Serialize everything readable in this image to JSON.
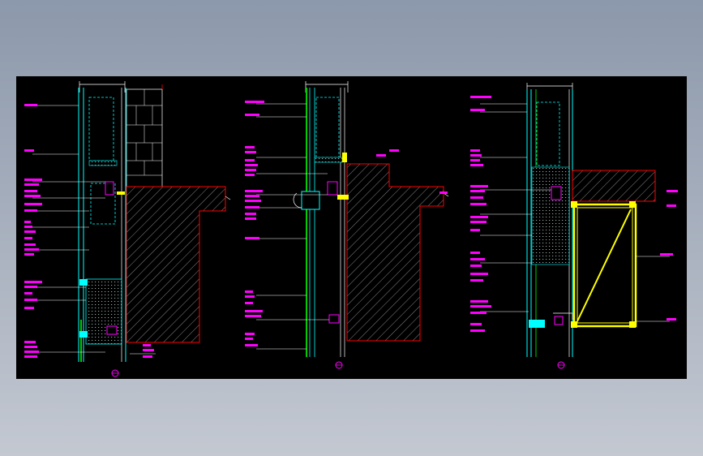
{
  "colors": {
    "background_outer": "#9aa3b3",
    "canvas": "#000000",
    "annotation": "#ff00ff",
    "outline": "#ffffff",
    "concrete_edge": "#ff0000",
    "profile": "#00ffff",
    "glass": "#00cc00",
    "frame": "#ffff00"
  },
  "icons": {
    "section_marker": "circle-marker-icon"
  }
}
